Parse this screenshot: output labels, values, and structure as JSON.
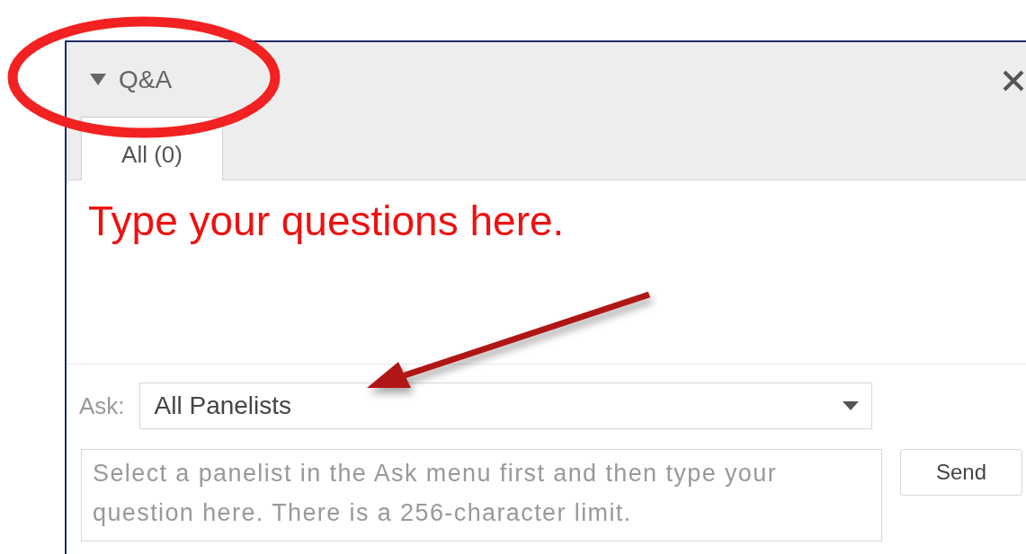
{
  "panel": {
    "title": "Q&A",
    "tabs": [
      {
        "label": "All (0)",
        "selected": true
      }
    ]
  },
  "annotation": {
    "text": "Type your questions here."
  },
  "ask": {
    "label": "Ask:",
    "value": "All Panelists"
  },
  "question": {
    "placeholder": "Select a panelist in the Ask menu first and then type your question here. There is a 256-character limit."
  },
  "send_button": {
    "label": "Send"
  }
}
